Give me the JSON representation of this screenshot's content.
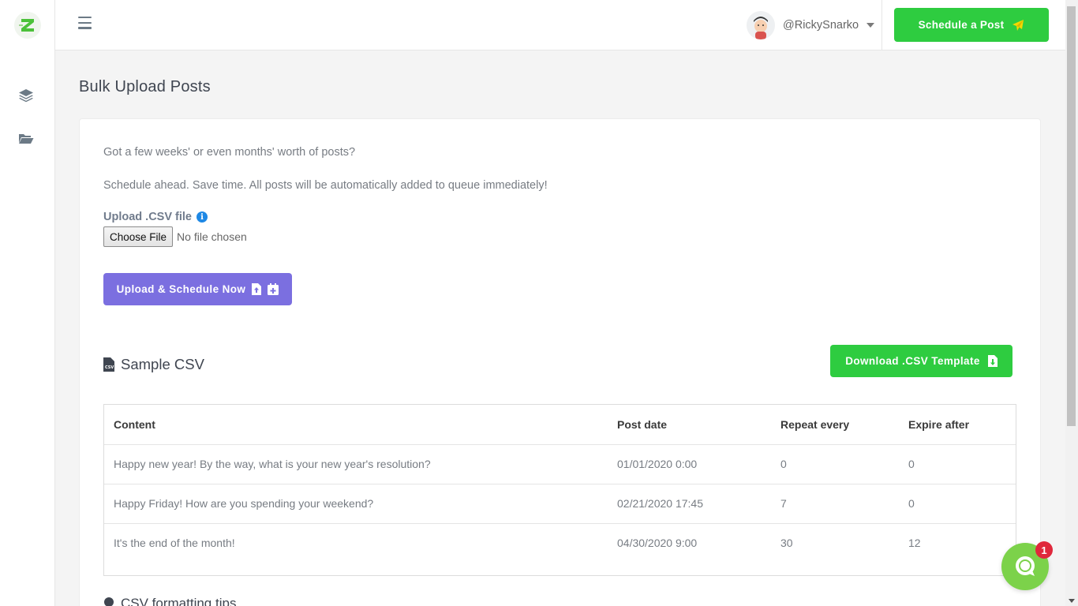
{
  "header": {
    "username": "@RickySnarko",
    "schedule_label": "Schedule a Post"
  },
  "page": {
    "title": "Bulk Upload Posts"
  },
  "card": {
    "intro_line1": "Got a few weeks' or even months' worth of posts?",
    "intro_line2": "Schedule ahead. Save time. All posts will be automatically added to queue immediately!",
    "upload_label": "Upload .CSV file",
    "choose_file_label": "Choose File",
    "no_file_text": "No file chosen",
    "upload_button_label": "Upload & Schedule Now",
    "sample_title": "Sample CSV",
    "download_label": "Download .CSV Template",
    "tips_title": "CSV formatting tips"
  },
  "table": {
    "headers": [
      "Content",
      "Post date",
      "Repeat every",
      "Expire after"
    ],
    "rows": [
      [
        "Happy new year! By the way, what is your new year's resolution?",
        "01/01/2020 0:00",
        "0",
        "0"
      ],
      [
        "Happy Friday! How are you spending your weekend?",
        "02/21/2020 17:45",
        "7",
        "0"
      ],
      [
        "It's the end of the month!",
        "04/30/2020 9:00",
        "30",
        "12"
      ]
    ]
  },
  "chat": {
    "badge_count": "1"
  },
  "icons": {
    "logo": "z-logo-icon",
    "sidebar": [
      "layers-icon",
      "folder-open-icon"
    ],
    "menu": "hamburger-icon",
    "send": "paper-plane-icon",
    "info": "info-icon",
    "upload": "file-upload-icon",
    "calendar": "calendar-plus-icon",
    "csv": "csv-file-icon",
    "download": "file-download-icon",
    "chat": "chat-bubble-icon"
  },
  "colors": {
    "green": "#2ecc40",
    "purple": "#7b6fe0",
    "chat_green": "#7cd24a",
    "badge_red": "#e0283c"
  }
}
